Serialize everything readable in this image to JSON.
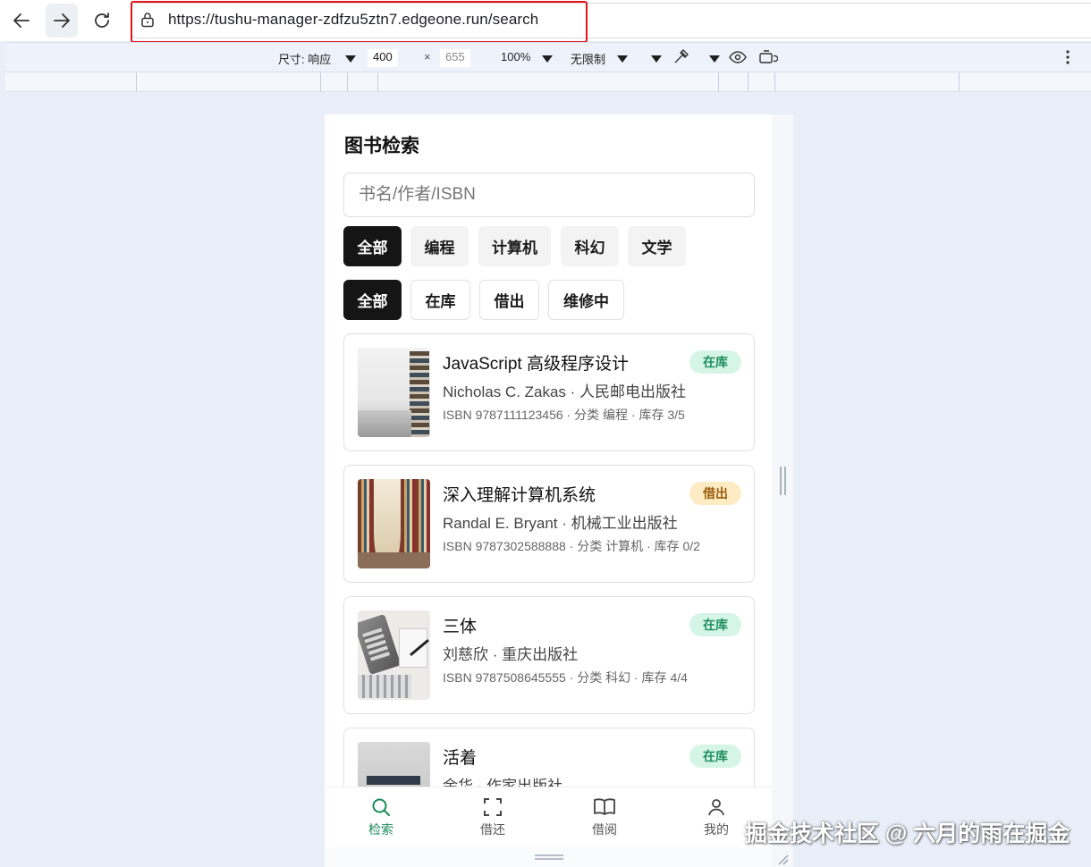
{
  "browser": {
    "url": "https://tushu-manager-zdfzu5ztn7.edgeone.run/search"
  },
  "devtools": {
    "size_label": "尺寸: 响应",
    "width": "400",
    "times": "×",
    "height": "655",
    "zoom": "100%",
    "throttle": "无限制"
  },
  "page": {
    "title": "图书检索",
    "search_placeholder": "书名/作者/ISBN",
    "categories": [
      "全部",
      "编程",
      "计算机",
      "科幻",
      "文学"
    ],
    "statuses": [
      "全部",
      "在库",
      "借出",
      "维修中"
    ],
    "books": [
      {
        "title": "JavaScript 高级程序设计",
        "author": "Nicholas C. Zakas · 人民邮电出版社",
        "meta": "ISBN 9787111123456 · 分类 编程 · 库存 3/5",
        "badge": "在库"
      },
      {
        "title": "深入理解计算机系统",
        "author": "Randal E. Bryant · 机械工业出版社",
        "meta": "ISBN 9787302588888 · 分类 计算机 · 库存 0/2",
        "badge": "借出"
      },
      {
        "title": "三体",
        "author": "刘慈欣 · 重庆出版社",
        "meta": "ISBN 9787508645555 · 分类 科幻 · 库存 4/4",
        "badge": "在库"
      },
      {
        "title": "活着",
        "author": "余华 · 作家出版社",
        "meta": "",
        "badge": "在库"
      }
    ],
    "tabs": [
      "检索",
      "借还",
      "借阅",
      "我的"
    ]
  },
  "colors": {
    "accent": "#1a8a5a",
    "chip_active": "#151515",
    "badge_in_bg": "#d5f5e7",
    "badge_out_bg": "#fdecc3"
  },
  "watermark": "掘金技术社区 @ 六月的雨在掘金"
}
